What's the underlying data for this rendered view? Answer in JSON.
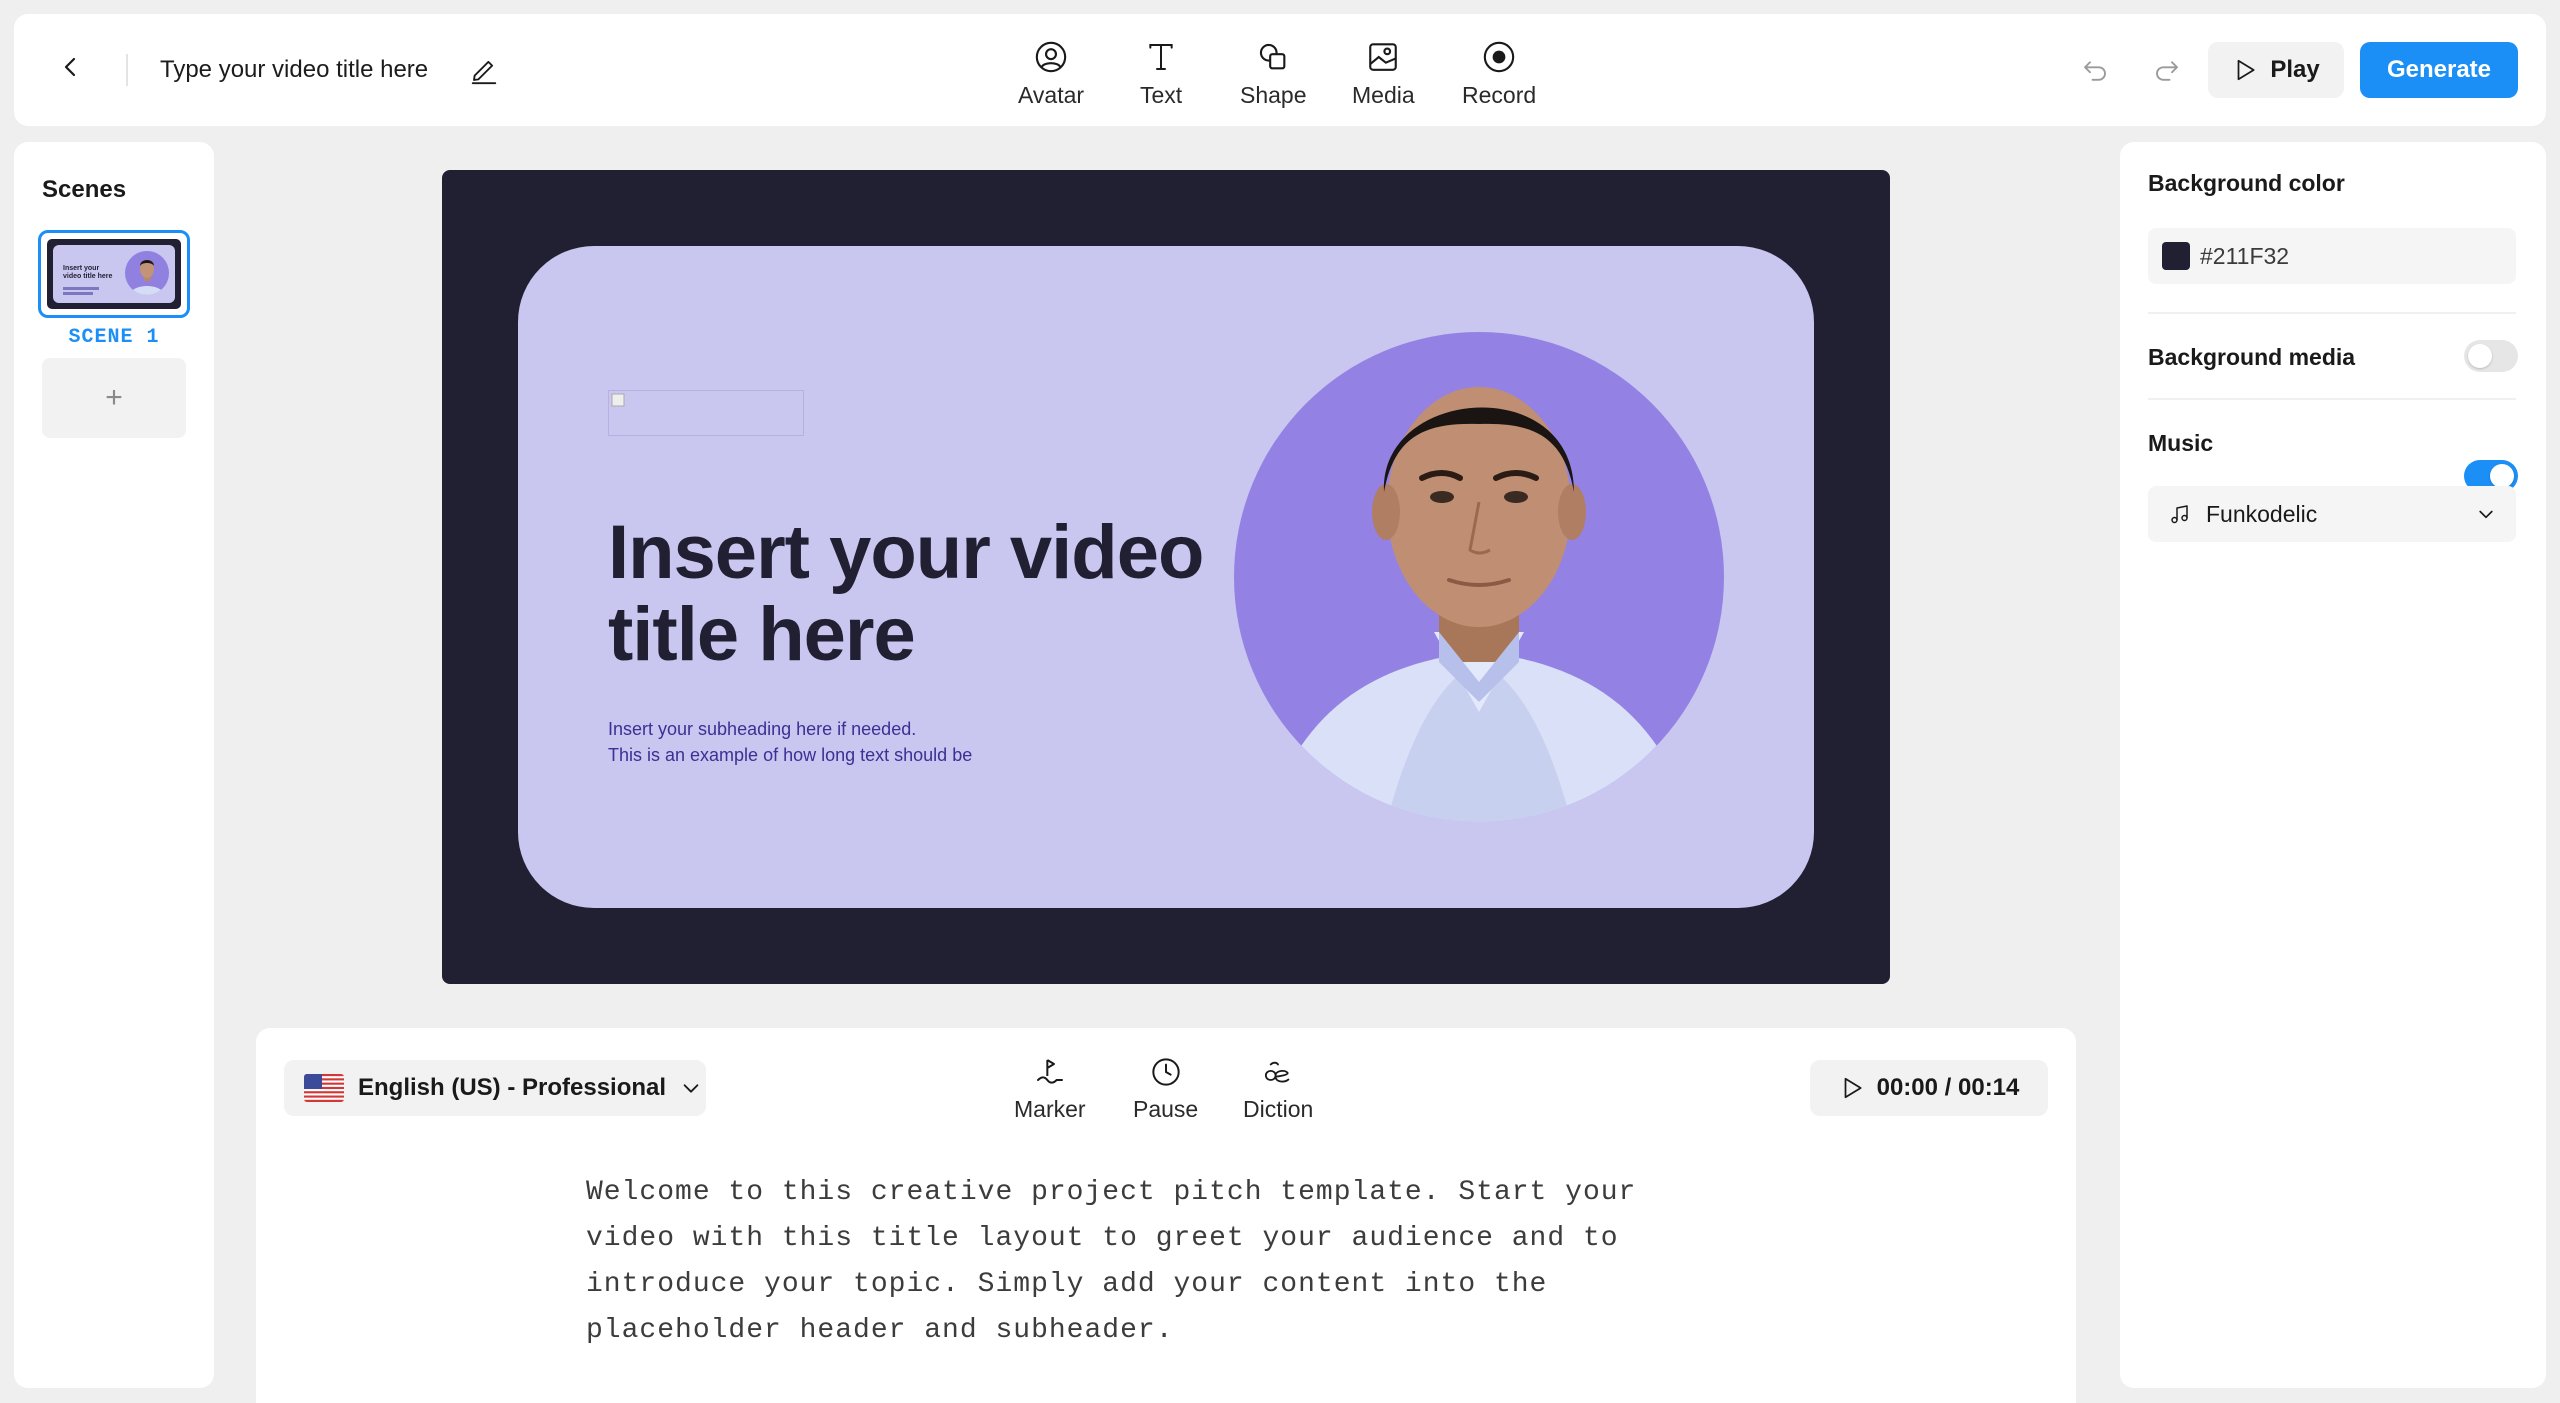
{
  "header": {
    "video_title": "Type your video title here",
    "tools": [
      {
        "label": "Avatar",
        "icon": "avatar-icon"
      },
      {
        "label": "Text",
        "icon": "text-icon"
      },
      {
        "label": "Shape",
        "icon": "shape-icon"
      },
      {
        "label": "Media",
        "icon": "media-icon"
      },
      {
        "label": "Record",
        "icon": "record-icon"
      }
    ],
    "play_label": "Play",
    "generate_label": "Generate"
  },
  "scenes": {
    "title": "Scenes",
    "items": [
      {
        "label": "SCENE 1",
        "selected": true
      }
    ],
    "add_label": "+"
  },
  "slide": {
    "title": "Insert your video title here",
    "subheading_line1": "Insert your subheading here if needed.",
    "subheading_line2": "This is an example of how long text should be",
    "background_color": "#211F32",
    "card_color": "#C9C6F0",
    "avatar_bg_color": "#9382E4"
  },
  "script": {
    "language": "English (US) - Professional",
    "tools": [
      {
        "label": "Marker",
        "icon": "marker-icon"
      },
      {
        "label": "Pause",
        "icon": "pause-clock-icon"
      },
      {
        "label": "Diction",
        "icon": "diction-icon"
      }
    ],
    "time": "00:00 / 00:14",
    "text": "Welcome to this creative project pitch template. Start your video with this title layout to greet your audience and to introduce your topic. Simply add your content into the placeholder header and subheader."
  },
  "properties": {
    "background_color_label": "Background color",
    "background_color_value": "#211F32",
    "background_media_label": "Background media",
    "background_media_enabled": false,
    "music_label": "Music",
    "music_enabled": true,
    "music_track": "Funkodelic"
  },
  "colors": {
    "accent": "#1B8FF6",
    "panel": "#FFFFFF",
    "app_bg": "#EFEFEF"
  }
}
